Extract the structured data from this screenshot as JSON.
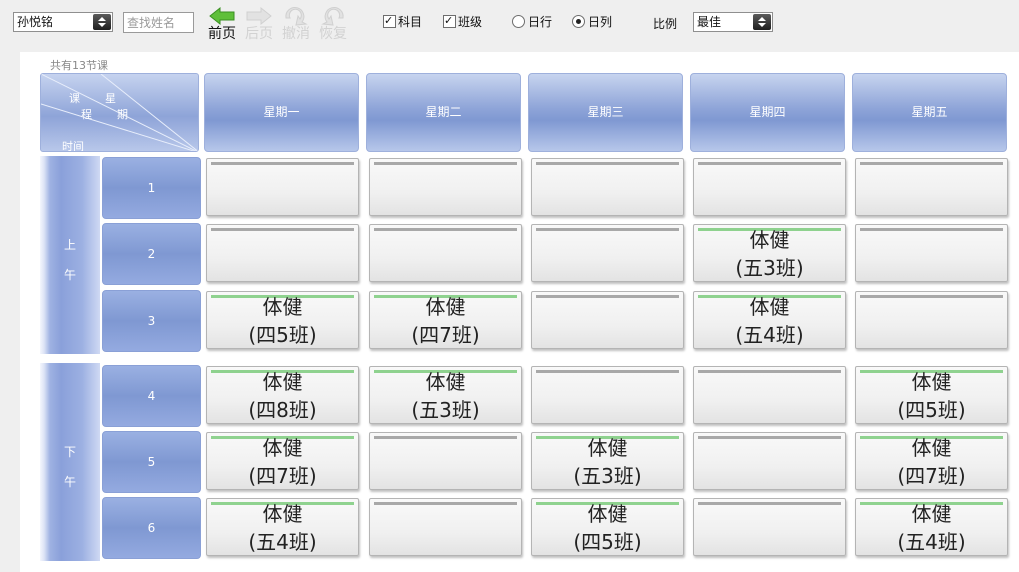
{
  "toolbar": {
    "teacher_select": "孙悦铭",
    "search_placeholder": "查找姓名",
    "nav": [
      {
        "label": "前页",
        "enabled": true
      },
      {
        "label": "后页",
        "enabled": false
      },
      {
        "label": "撤消",
        "enabled": false
      },
      {
        "label": "恢复",
        "enabled": false
      }
    ],
    "checkboxes": [
      {
        "label": "科目",
        "checked": true
      },
      {
        "label": "班级",
        "checked": true
      }
    ],
    "radios": [
      {
        "label": "日行",
        "selected": false
      },
      {
        "label": "日列",
        "selected": true
      }
    ],
    "scale_label": "比例",
    "scale_value": "最佳"
  },
  "timetable": {
    "count_text": "共有13节课",
    "corner": {
      "course": "课程",
      "weekday": "星期",
      "time": "时间"
    },
    "days": [
      "星期一",
      "星期二",
      "星期三",
      "星期四",
      "星期五"
    ],
    "halves": [
      {
        "label_top": "上",
        "label_bottom": "午"
      },
      {
        "label_top": "下",
        "label_bottom": "午"
      }
    ],
    "periods": [
      "1",
      "2",
      "3",
      "4",
      "5",
      "6"
    ],
    "cells": [
      [
        null,
        null,
        null,
        null,
        null
      ],
      [
        null,
        null,
        null,
        {
          "subject": "体健",
          "class": "(五3班)"
        },
        null
      ],
      [
        {
          "subject": "体健",
          "class": "(四5班)"
        },
        {
          "subject": "体健",
          "class": "(四7班)"
        },
        null,
        {
          "subject": "体健",
          "class": "(五4班)"
        },
        null
      ],
      [
        {
          "subject": "体健",
          "class": "(四8班)"
        },
        {
          "subject": "体健",
          "class": "(五3班)"
        },
        null,
        null,
        {
          "subject": "体健",
          "class": "(四5班)"
        }
      ],
      [
        {
          "subject": "体健",
          "class": "(四7班)"
        },
        null,
        {
          "subject": "体健",
          "class": "(五3班)"
        },
        null,
        {
          "subject": "体健",
          "class": "(四7班)"
        }
      ],
      [
        {
          "subject": "体健",
          "class": "(五4班)"
        },
        null,
        {
          "subject": "体健",
          "class": "(四5班)"
        },
        null,
        {
          "subject": "体健",
          "class": "(五4班)"
        }
      ]
    ]
  },
  "colors": {
    "header_blue": "#8ea4d8",
    "filled_accent": "#8fd28f",
    "empty_accent": "#a8a8a8"
  }
}
